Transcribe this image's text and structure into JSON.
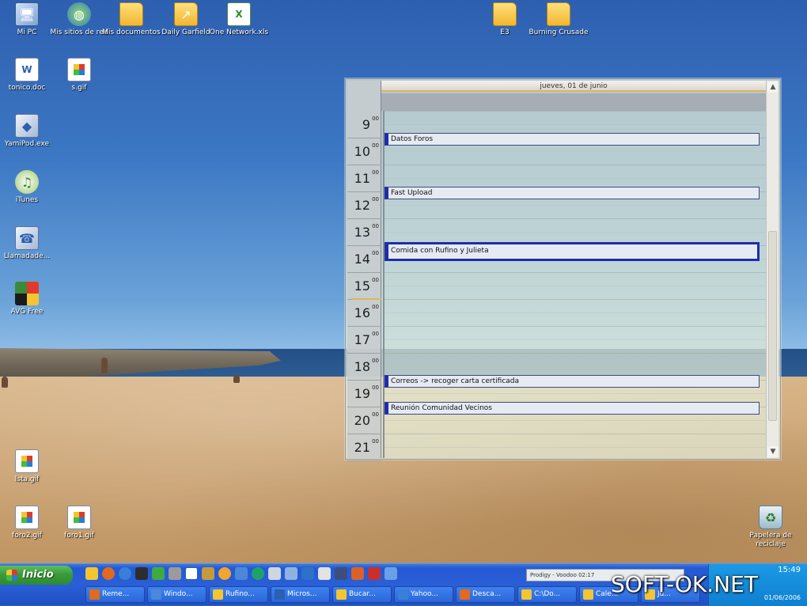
{
  "desktop": {
    "icons": [
      {
        "label": "Mi PC",
        "icon": "computer-icon"
      },
      {
        "label": "Mis sitios de red",
        "icon": "network-places-icon"
      },
      {
        "label": "Mis documentos",
        "icon": "my-documents-icon"
      },
      {
        "label": "Daily Garfield",
        "icon": "shortcut-icon"
      },
      {
        "label": "One Network.xls",
        "icon": "excel-file-icon"
      },
      {
        "label": "E3",
        "icon": "folder-icon"
      },
      {
        "label": "Burning Crusade",
        "icon": "folder-icon"
      },
      {
        "label": "tonico.doc",
        "icon": "word-file-icon"
      },
      {
        "label": "s.gif",
        "icon": "gif-file-icon"
      },
      {
        "label": "YamiPod.exe",
        "icon": "app-icon"
      },
      {
        "label": "iTunes",
        "icon": "itunes-icon"
      },
      {
        "label": "Llamadade...",
        "icon": "app-icon"
      },
      {
        "label": "AVG Free",
        "icon": "avg-icon"
      },
      {
        "label": "lsta.gif",
        "icon": "gif-file-icon"
      },
      {
        "label": "foro2.gif",
        "icon": "gif-file-icon"
      },
      {
        "label": "foro1.gif",
        "icon": "gif-file-icon"
      },
      {
        "label": "Papelera de reciclaje",
        "icon": "recycle-bin-icon"
      }
    ]
  },
  "calendar": {
    "date_title": "jueves, 01 de junio",
    "minutes_superscript": "00",
    "hours": [
      "9",
      "10",
      "11",
      "12",
      "13",
      "14",
      "15",
      "16",
      "17",
      "18",
      "19",
      "20",
      "21"
    ],
    "events": [
      {
        "title": "Datos Foros",
        "hour": 10
      },
      {
        "title": "Fast Upload",
        "hour": 12
      },
      {
        "title": "Comida con Rufino y Julieta",
        "hour": 14
      },
      {
        "title": "Correos -> recoger carta certificada",
        "hour": 19
      },
      {
        "title": "Reunión Comunidad Vecinos",
        "hour": 20
      }
    ]
  },
  "taskbar": {
    "start_label": "Inicio",
    "media_text": "Prodigy - Voodoo  02:17",
    "tasks": [
      "Reme...",
      "Windo...",
      "Rufino...",
      "Micros...",
      "Bucar...",
      "Yahoo...",
      "Desca...",
      "C:\\Do...",
      "Cale...",
      "Ju..."
    ],
    "clock": "15:49",
    "date": "01/06/2006"
  },
  "watermark": "SOFT-OK.NET"
}
